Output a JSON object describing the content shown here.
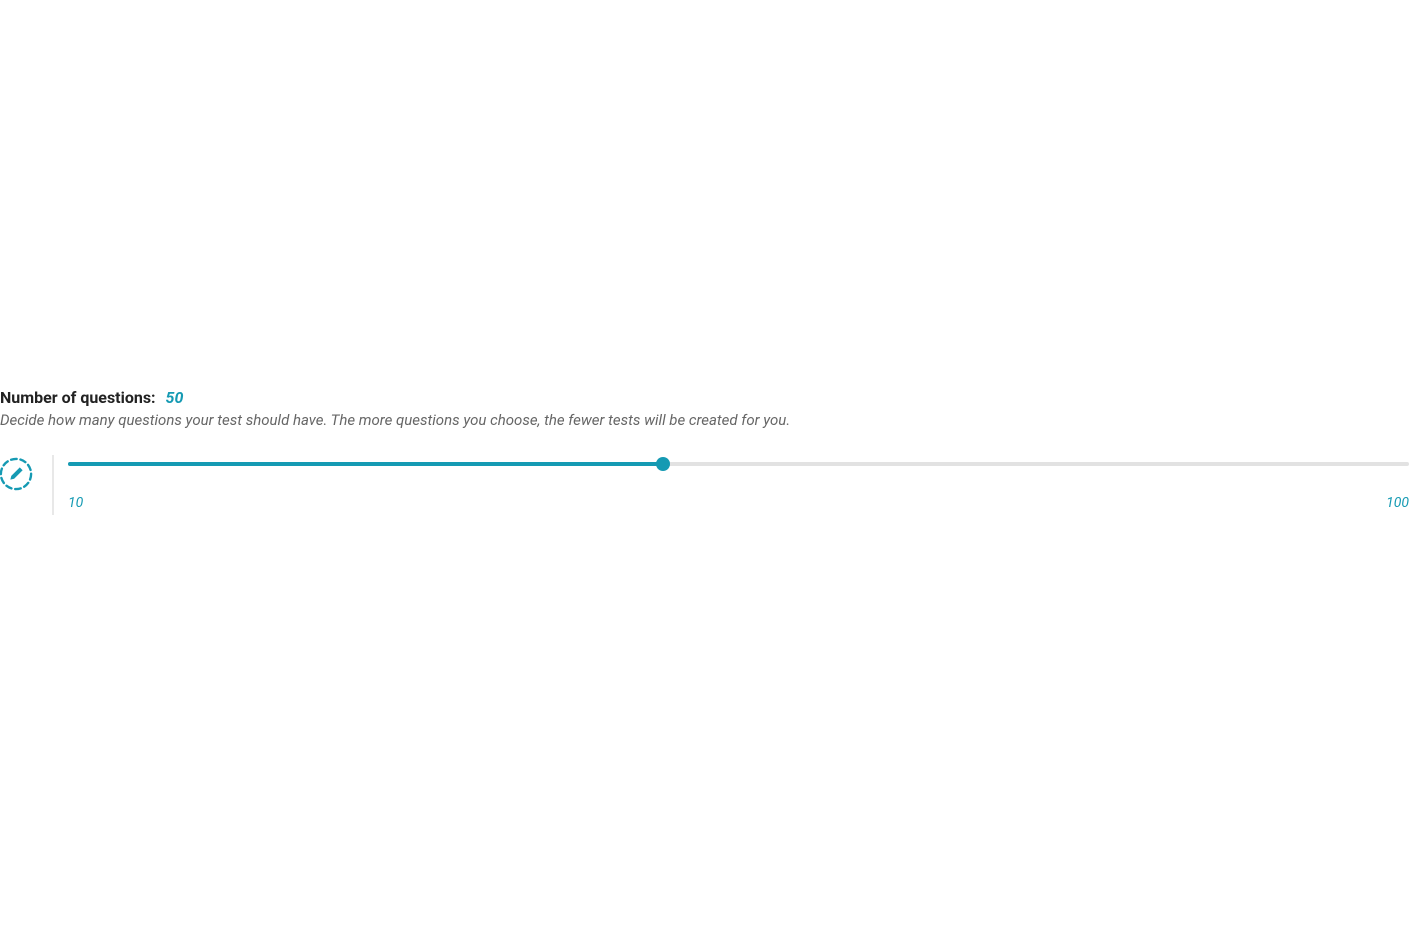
{
  "questions_section": {
    "label": "Number of questions:",
    "value": "50",
    "description": "Decide how many questions your test should have. The more questions you choose, the fewer tests will be created for you.",
    "slider": {
      "min_label": "10",
      "max_label": "100",
      "min": 10,
      "max": 100,
      "current": 50,
      "fill_percent": "44.4%"
    },
    "colors": {
      "accent": "#159ab3",
      "text_dark": "#222",
      "text_muted": "#666",
      "track_bg": "#e2e2e2"
    },
    "icon_name": "edit-dashed-circle-icon"
  }
}
